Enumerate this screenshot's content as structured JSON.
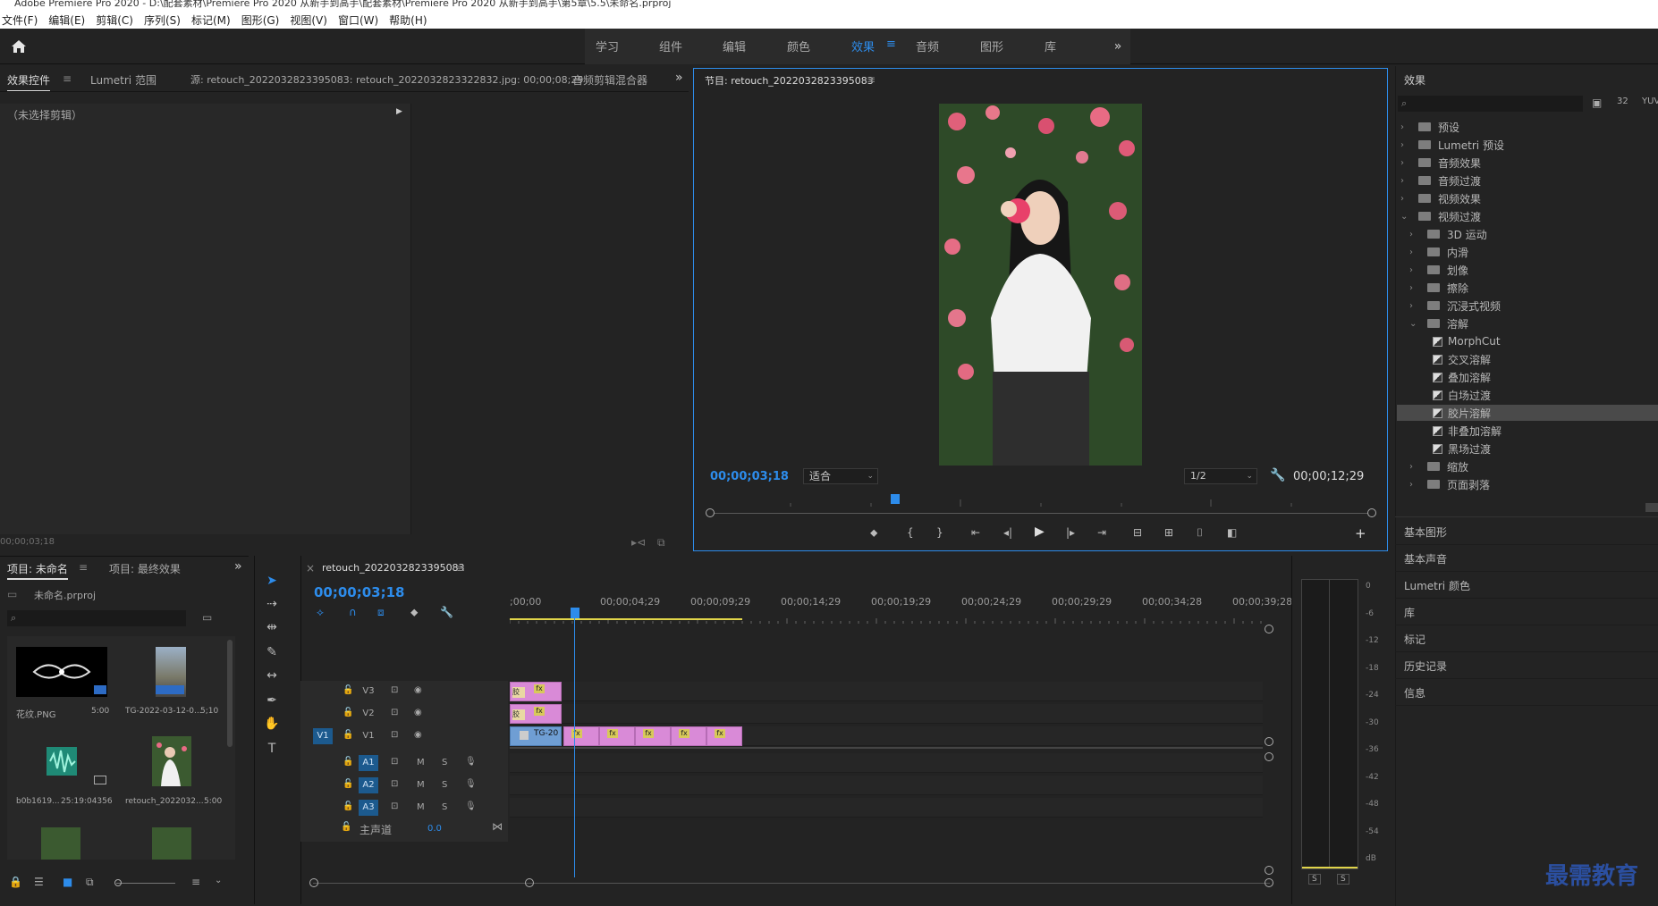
{
  "app": {
    "title": "Adobe Premiere Pro 2020 - D:\\配套素材\\Premiere Pro 2020 从新手到高手\\配套素材\\Premiere Pro 2020 从新手到高手\\第5章\\5.5\\未命名.prproj"
  },
  "menu": [
    "文件(F)",
    "编辑(E)",
    "剪辑(C)",
    "序列(S)",
    "标记(M)",
    "图形(G)",
    "视图(V)",
    "窗口(W)",
    "帮助(H)"
  ],
  "workspaces": [
    {
      "label": "学习"
    },
    {
      "label": "组件"
    },
    {
      "label": "编辑"
    },
    {
      "label": "颜色"
    },
    {
      "label": "效果",
      "active": true
    },
    {
      "label": "音频"
    },
    {
      "label": "图形"
    },
    {
      "label": "库"
    }
  ],
  "source_panel": {
    "tabs": [
      "效果控件",
      "Lumetri 范围",
      "源: retouch_2022032823395083: retouch_2022032823322832.jpg: 00;00;08;29",
      "音频剪辑混合器"
    ],
    "no_clip": "（未选择剪辑）",
    "timecode": "00;00;03;18"
  },
  "program_monitor": {
    "title": "节目: retouch_2022032823395083",
    "current_time": "00;00;03;18",
    "zoom": "适合",
    "resolution": "1/2",
    "duration": "00;00;12;29",
    "playhead_fraction": 0.28
  },
  "effects_panel": {
    "title": "效果",
    "tree": [
      {
        "label": "预设",
        "level": 0,
        "type": "folder",
        "open": false
      },
      {
        "label": "Lumetri 预设",
        "level": 0,
        "type": "folder",
        "open": false
      },
      {
        "label": "音频效果",
        "level": 0,
        "type": "folder",
        "open": false
      },
      {
        "label": "音频过渡",
        "level": 0,
        "type": "folder",
        "open": false
      },
      {
        "label": "视频效果",
        "level": 0,
        "type": "folder",
        "open": false
      },
      {
        "label": "视频过渡",
        "level": 0,
        "type": "folder",
        "open": true
      },
      {
        "label": "3D 运动",
        "level": 1,
        "type": "folder",
        "open": false
      },
      {
        "label": "内滑",
        "level": 1,
        "type": "folder",
        "open": false
      },
      {
        "label": "划像",
        "level": 1,
        "type": "folder",
        "open": false
      },
      {
        "label": "擦除",
        "level": 1,
        "type": "folder",
        "open": false
      },
      {
        "label": "沉浸式视频",
        "level": 1,
        "type": "folder",
        "open": false
      },
      {
        "label": "溶解",
        "level": 1,
        "type": "folder",
        "open": true
      },
      {
        "label": "MorphCut",
        "level": 2,
        "type": "effect"
      },
      {
        "label": "交叉溶解",
        "level": 2,
        "type": "effect"
      },
      {
        "label": "叠加溶解",
        "level": 2,
        "type": "effect"
      },
      {
        "label": "白场过渡",
        "level": 2,
        "type": "effect"
      },
      {
        "label": "胶片溶解",
        "level": 2,
        "type": "effect",
        "selected": true
      },
      {
        "label": "非叠加溶解",
        "level": 2,
        "type": "effect"
      },
      {
        "label": "黑场过渡",
        "level": 2,
        "type": "effect"
      },
      {
        "label": "缩放",
        "level": 1,
        "type": "folder",
        "open": false
      },
      {
        "label": "页面剥落",
        "level": 1,
        "type": "folder",
        "open": false
      }
    ],
    "collapsed_panels": [
      "基本图形",
      "基本声音",
      "Lumetri 颜色",
      "库",
      "标记",
      "历史记录",
      "信息"
    ]
  },
  "project_panel": {
    "tabs": [
      "项目: 未命名",
      "项目: 最终效果"
    ],
    "file": "未命名.prproj",
    "items": [
      {
        "name": "花纹.PNG",
        "duration": "5:00"
      },
      {
        "name": "TG-2022-03-12-0...",
        "duration": "5;10"
      },
      {
        "name": "b0b1619...",
        "duration": "25:19:04356"
      },
      {
        "name": "retouch_2022032...",
        "duration": "5:00"
      }
    ]
  },
  "timeline": {
    "sequence": "retouch_2022032823395083",
    "timecode": "00;00;03;18",
    "ruler": [
      ";00;00",
      "00;00;04;29",
      "00;00;09;29",
      "00;00;14;29",
      "00;00;19;29",
      "00;00;24;29",
      "00;00;29;29",
      "00;00;34;28",
      "00;00;39;28"
    ],
    "tracks": [
      {
        "id": "V3",
        "mute": "",
        "solo": ""
      },
      {
        "id": "V2",
        "mute": "",
        "solo": ""
      },
      {
        "id": "V1",
        "mute": "",
        "solo": ""
      },
      {
        "id": "A1",
        "mute": "M",
        "solo": "S"
      },
      {
        "id": "A2",
        "mute": "M",
        "solo": "S"
      },
      {
        "id": "A3",
        "mute": "M",
        "solo": "S"
      }
    ],
    "v1_target": "V1",
    "master_label": "主声道",
    "master_value": "0.0",
    "clip_label": "TG-20",
    "fx_label": "fx",
    "v_clip_label": "胶"
  },
  "meters": {
    "ticks": [
      "0",
      "-6",
      "-12",
      "-18",
      "-24",
      "-30",
      "-36",
      "-42",
      "-48",
      "-54",
      "dB"
    ],
    "solo": [
      "S",
      "S"
    ]
  },
  "watermark": "最需教育"
}
